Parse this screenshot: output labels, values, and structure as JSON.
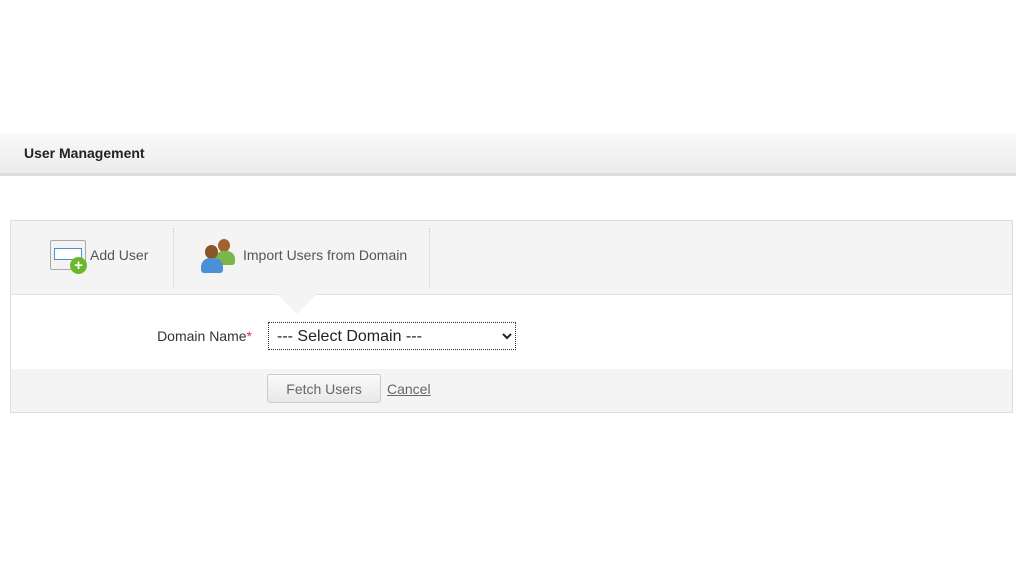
{
  "header": {
    "title": "User Management"
  },
  "tabs": [
    {
      "label": "Add User"
    },
    {
      "label": "Import Users from Domain"
    }
  ],
  "form": {
    "domain_label": "Domain Name",
    "required_mark": "*",
    "domain_selected": "--- Select Domain ---"
  },
  "actions": {
    "fetch": "Fetch Users",
    "cancel": "Cancel"
  }
}
